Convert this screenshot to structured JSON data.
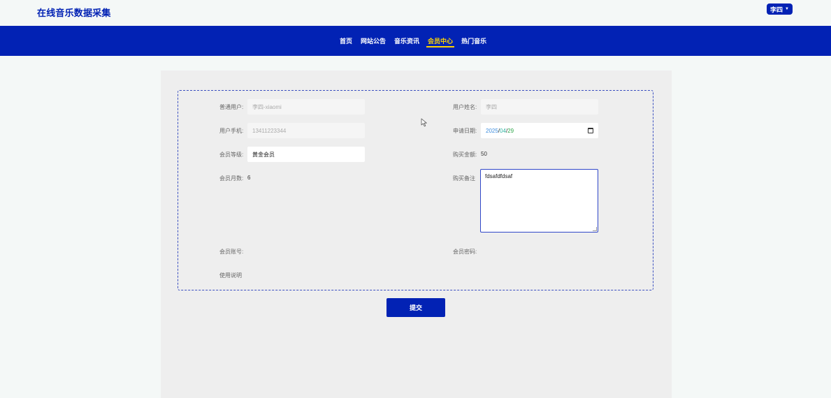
{
  "header": {
    "site_title": "在线音乐数据采集",
    "user_button": "李四"
  },
  "nav": {
    "items": [
      {
        "label": "首页"
      },
      {
        "label": "网站公告"
      },
      {
        "label": "音乐资讯"
      },
      {
        "label": "会员中心"
      },
      {
        "label": "热门音乐"
      }
    ],
    "active_index": 3
  },
  "form": {
    "normal_user": {
      "label": "普通用户:",
      "value": "李四-xiaomi"
    },
    "user_name": {
      "label": "用户姓名:",
      "value": "李四"
    },
    "user_phone": {
      "label": "用户手机:",
      "value": "13411223344"
    },
    "apply_date": {
      "label": "申请日期:",
      "year": "2025",
      "sep": "/",
      "month": "04",
      "day": "29"
    },
    "member_level": {
      "label": "会员等级:",
      "value": "黄金会员"
    },
    "purchase_amount": {
      "label": "购买金额:",
      "value": "50"
    },
    "member_months": {
      "label": "会员月数:",
      "value": "6"
    },
    "purchase_note": {
      "label": "购买备注",
      "value": "fdsafdfdsaf"
    },
    "member_account": {
      "label": "会员账号:"
    },
    "member_password": {
      "label": "会员密码:"
    },
    "usage_note": {
      "label": "使用说明"
    }
  },
  "actions": {
    "submit_label": "提交"
  },
  "colors": {
    "primary": "#0222b4",
    "active_nav": "#ffd400",
    "panel_bg": "#eeeeee",
    "page_bg": "#f4f8f7"
  }
}
